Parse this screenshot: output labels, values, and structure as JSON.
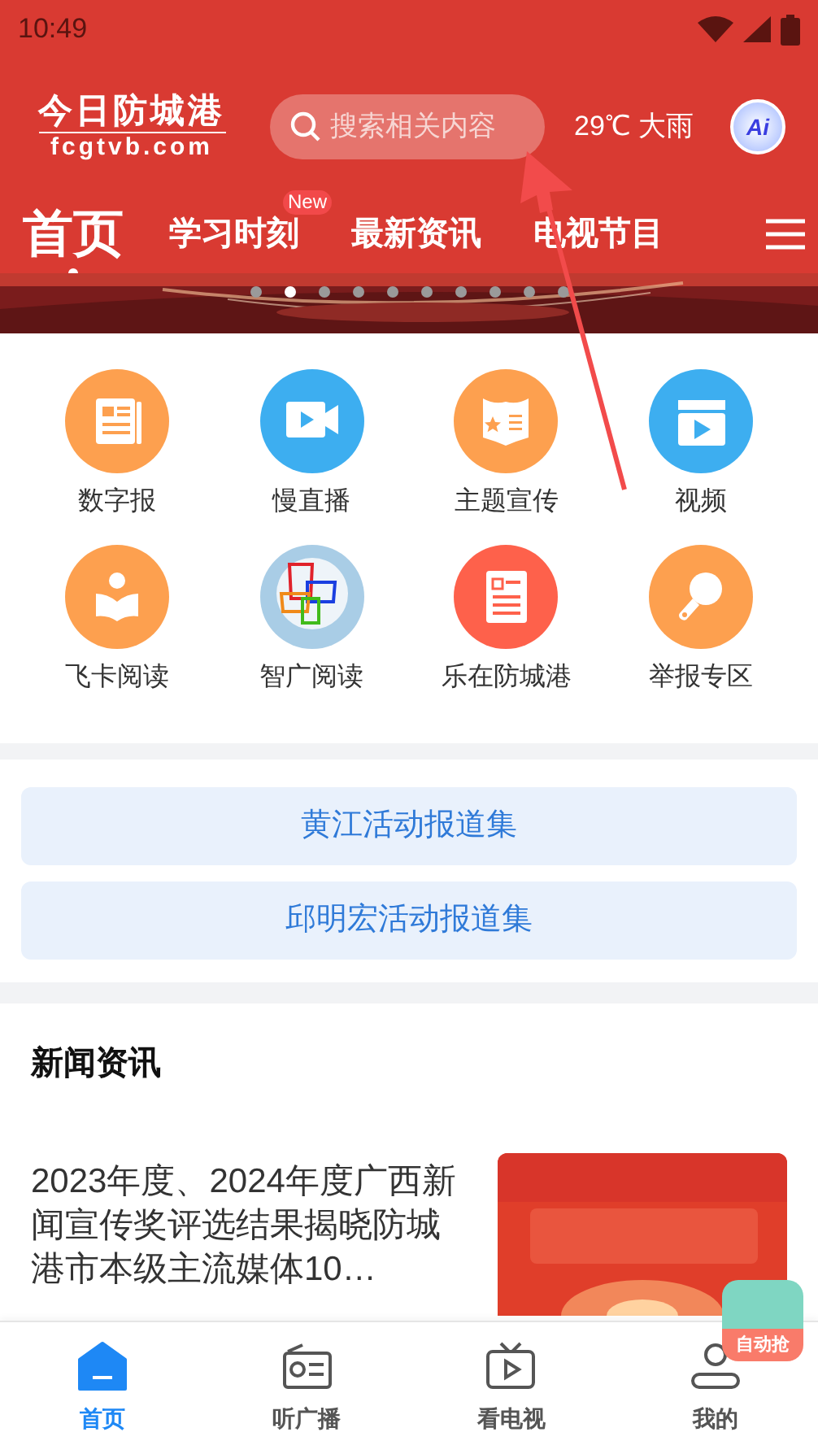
{
  "status_bar": {
    "time": "10:49"
  },
  "header": {
    "logo_title": "今日防城港",
    "logo_subtitle": "fcgtvb.com",
    "search": {
      "placeholder": "搜索相关内容"
    },
    "weather": "29℃ 大雨",
    "ai_label": "Ai"
  },
  "tabs": [
    {
      "label": "首页",
      "selected": true
    },
    {
      "label": "学习时刻",
      "selected": false,
      "badge": "New"
    },
    {
      "label": "最新资讯",
      "selected": false
    },
    {
      "label": "电视节目",
      "selected": false
    }
  ],
  "banner": {
    "dots": [
      {
        "selected": false
      },
      {
        "selected": true
      },
      {
        "selected": false
      },
      {
        "selected": false
      },
      {
        "selected": false
      },
      {
        "selected": false
      },
      {
        "selected": false
      },
      {
        "selected": false
      },
      {
        "selected": false
      },
      {
        "selected": false
      }
    ]
  },
  "quick_links": [
    {
      "label": "数字报",
      "kind": "newspaper",
      "color": "#fda04f"
    },
    {
      "label": "慢直播",
      "kind": "camera",
      "color": "#3daef0"
    },
    {
      "label": "主题宣传",
      "kind": "book",
      "color": "#fda04f"
    },
    {
      "label": "视频",
      "kind": "clapper",
      "color": "#3daef0"
    },
    {
      "label": "飞卡阅读",
      "kind": "reader",
      "color": "#fda04f"
    },
    {
      "label": "智广阅读",
      "kind": "frames",
      "color": "#a9cde6"
    },
    {
      "label": "乐在防城港",
      "kind": "document",
      "color": "#fe614b"
    },
    {
      "label": "举报专区",
      "kind": "magnifier",
      "color": "#fda04f"
    }
  ],
  "reports": [
    "黄江活动报道集",
    "邱明宏活动报道集"
  ],
  "news": {
    "heading": "新闻资讯",
    "items": [
      {
        "title": "2023年度、2024年度广西新闻宣传奖评选结果揭晓防城港市本级主流媒体10…",
        "kind": "picture"
      }
    ]
  },
  "floating_button": {
    "label": "自动抢"
  },
  "bottom_nav": [
    {
      "label": "首页",
      "kind": "home",
      "selected": true
    },
    {
      "label": "听广播",
      "kind": "radio",
      "selected": false
    },
    {
      "label": "看电视",
      "kind": "tv",
      "selected": false
    },
    {
      "label": "我的",
      "kind": "user",
      "selected": false
    }
  ]
}
